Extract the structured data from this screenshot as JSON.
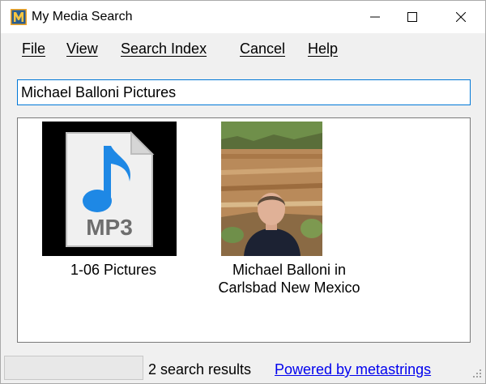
{
  "window": {
    "title": "My Media Search",
    "icon": "app-m-icon",
    "controls": [
      "minimize-icon",
      "maximize-icon",
      "close-icon"
    ]
  },
  "menu": {
    "file": "File",
    "view": "View",
    "search_index": "Search Index",
    "cancel": "Cancel",
    "help": "Help"
  },
  "search": {
    "value": "Michael Balloni Pictures"
  },
  "results": [
    {
      "caption": "1-06 Pictures",
      "thumbnail": "mp3-file-icon"
    },
    {
      "caption_line1": "Michael Balloni in",
      "caption_line2": "Carlsbad New Mexico",
      "thumbnail": "photo-thumbnail"
    }
  ],
  "status": {
    "count_text": "2 search results",
    "link_text": "Powered by metastrings"
  },
  "colors": {
    "focus_border": "#0078d7",
    "link": "#0000ee",
    "mp3_note": "#1e88e5"
  }
}
